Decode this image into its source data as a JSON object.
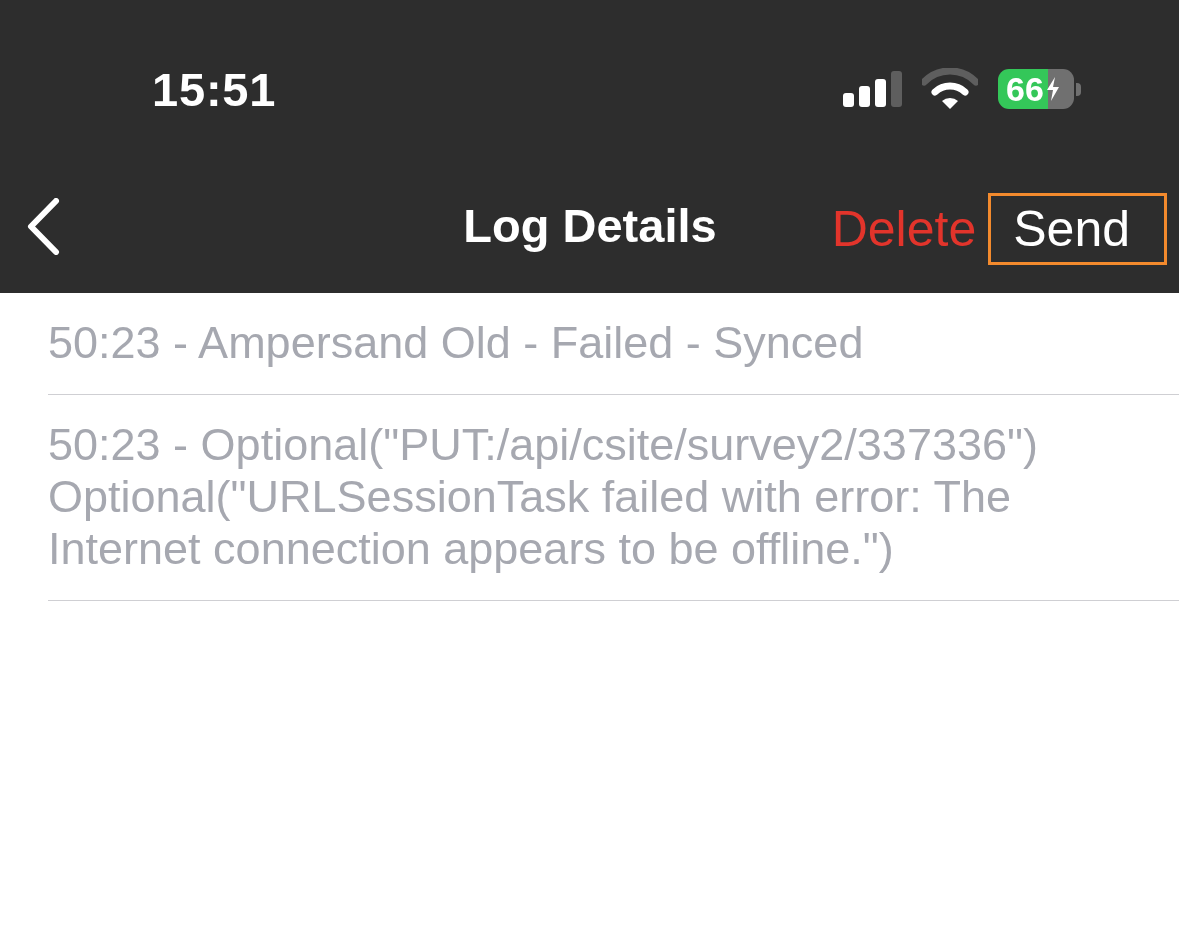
{
  "status_bar": {
    "time": "15:51",
    "battery": {
      "percent": "66",
      "charging": true
    }
  },
  "nav_bar": {
    "title": "Log Details",
    "actions": [
      {
        "label": "Delete",
        "kind": "destructive",
        "highlighted": false
      },
      {
        "label": "Send",
        "kind": "plain",
        "highlighted": true
      }
    ]
  },
  "log_entries": [
    {
      "text": "50:23 - Ampersand Old - Failed - Synced"
    },
    {
      "text": "50:23 - Optional(\"PUT:/api/csite/survey2/337336\") Optional(\"URLSessionTask failed with error: The Internet connection appears to be offline.\")"
    }
  ]
}
